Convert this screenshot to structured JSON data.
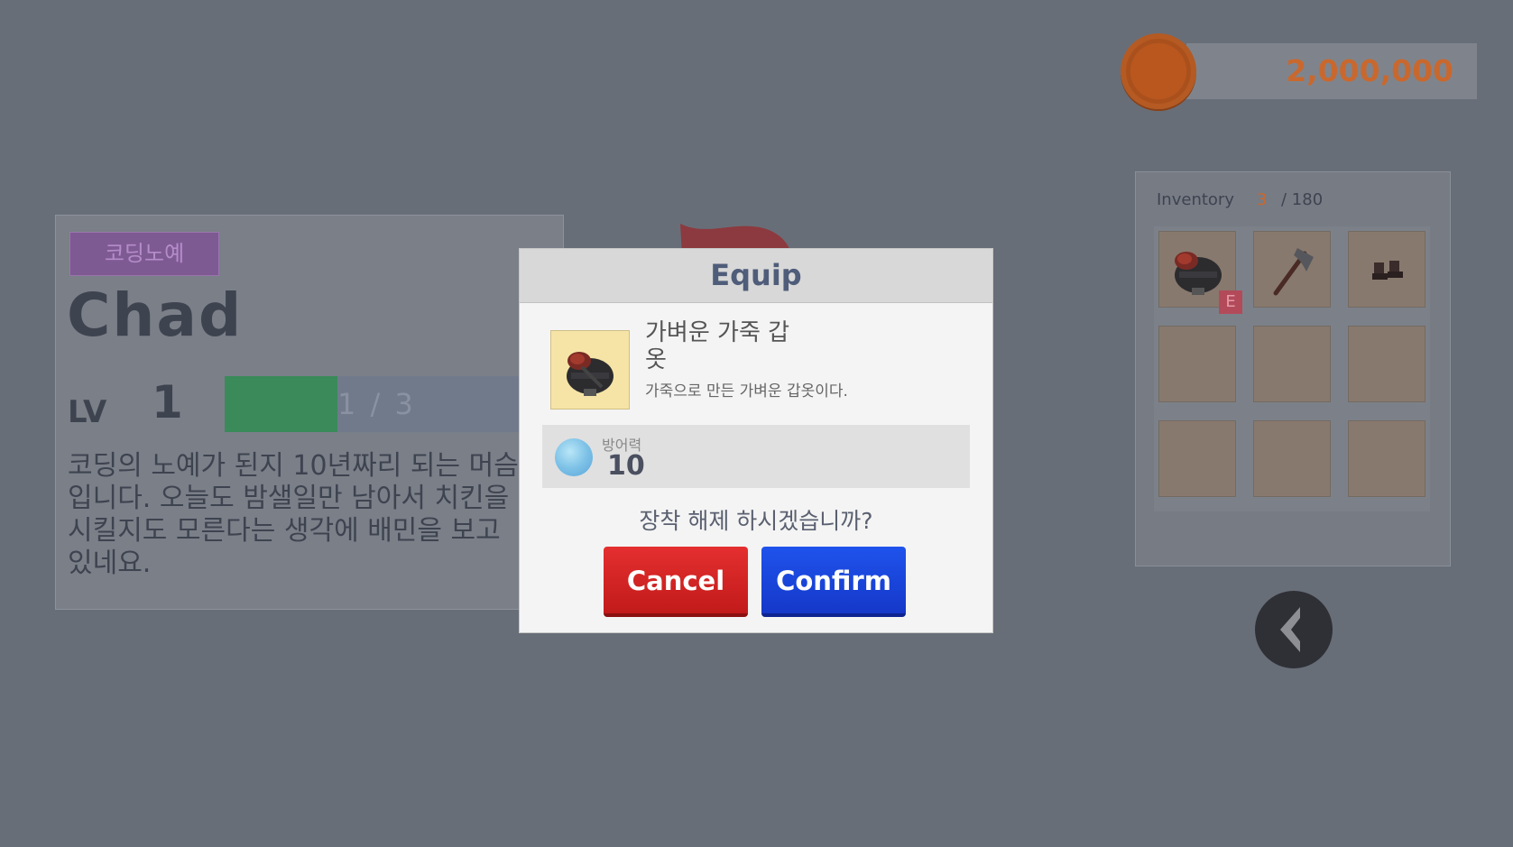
{
  "currency": {
    "gold": "2,000,000",
    "icon": "gold-coin-icon",
    "accent": "#c9682e"
  },
  "character": {
    "tag": "코딩노예",
    "name": "Chad",
    "level_label": "LV",
    "level": "1",
    "xp_text": "1 / 3",
    "xp_progress": 0.333,
    "description": "코딩의 노예가 된지 10년짜리 되는 머슴입니다. 오늘도 밤샐일만 남아서 치킨을 시킬지도 모른다는 생각에 배민을 보고 있네요."
  },
  "inventory": {
    "title": "Inventory",
    "count": "3",
    "max": "/ 180",
    "equipped_badge": "E",
    "items": [
      {
        "icon": "leather-armor-icon",
        "equipped": true
      },
      {
        "icon": "axe-icon",
        "equipped": false
      },
      {
        "icon": "boots-icon",
        "equipped": false
      }
    ]
  },
  "dialog": {
    "title": "Equip",
    "item_name": "가벼운 가죽 갑옷",
    "item_desc": "가죽으로 만든 가벼운 갑옷이다.",
    "stat_label": "방어력",
    "stat_value": "10",
    "question": "장착 해제 하시겠습니까?",
    "cancel_label": "Cancel",
    "confirm_label": "Confirm",
    "cancel_color": "#d22424",
    "confirm_color": "#1a45dc"
  }
}
